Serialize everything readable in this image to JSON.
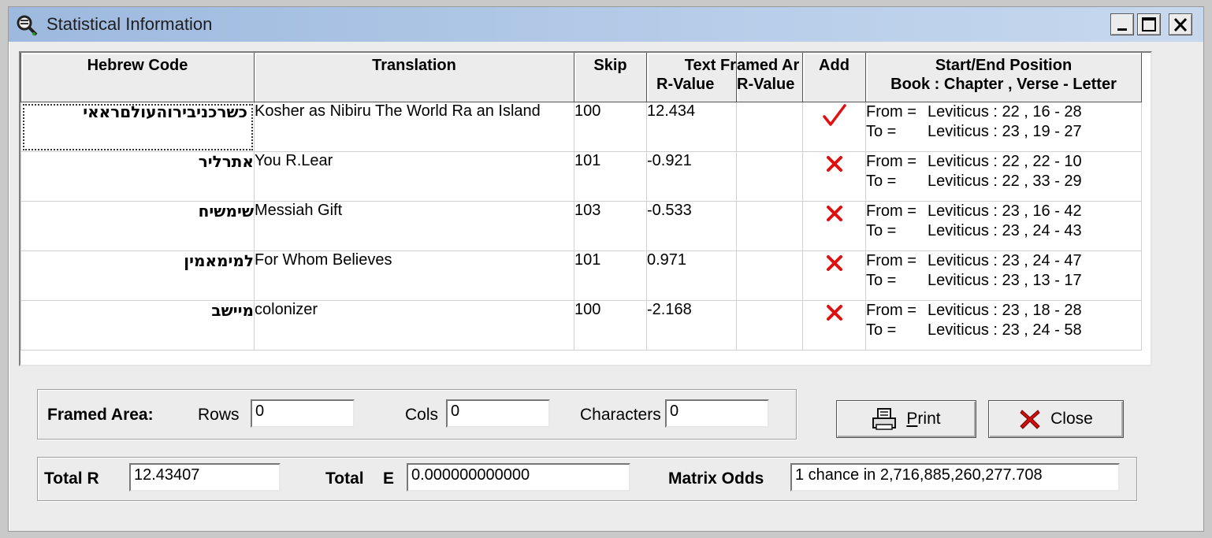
{
  "window": {
    "title": "Statistical Information"
  },
  "grid": {
    "headers": {
      "hebrew_code": "Hebrew Code",
      "translation": "Translation",
      "skip": "Skip",
      "text_line1": "Text Fr",
      "text_line2": "R-Value",
      "framed_line1": "amed Ar",
      "framed_line2": "R-Value",
      "add": "Add",
      "pos_line1": "Start/End Position",
      "pos_line2": "Book : Chapter , Verse - Letter"
    },
    "from_label": "From =",
    "to_label": "To =",
    "rows": [
      {
        "hebrew": "כשרכניבירוהעולםראאי",
        "translation": "Kosher as Nibiru The World Ra an Island",
        "skip": "100",
        "text_r": "12.434",
        "framed_r": "",
        "add": "checked",
        "from": "Leviticus : 22 , 16 - 28",
        "to": "Leviticus : 23 , 19 - 27"
      },
      {
        "hebrew": "אתרליר",
        "translation": "You R.Lear",
        "skip": "101",
        "text_r": "-0.921",
        "framed_r": "",
        "add": "unchecked",
        "from": "Leviticus : 22 , 22 - 10",
        "to": "Leviticus : 22 , 33 - 29"
      },
      {
        "hebrew": "שימשיח",
        "translation": "Messiah Gift",
        "skip": "103",
        "text_r": "-0.533",
        "framed_r": "",
        "add": "unchecked",
        "from": "Leviticus : 23 , 16 - 42",
        "to": "Leviticus : 23 , 24 - 43"
      },
      {
        "hebrew": "למימאמין",
        "translation": "For Whom Believes",
        "skip": "101",
        "text_r": "0.971",
        "framed_r": "",
        "add": "unchecked",
        "from": "Leviticus : 23 , 24 - 47",
        "to": "Leviticus : 23 , 13 - 17"
      },
      {
        "hebrew": "מיישב",
        "translation": "colonizer",
        "skip": "100",
        "text_r": "-2.168",
        "framed_r": "",
        "add": "unchecked",
        "from": "Leviticus : 23 , 18 - 28",
        "to": "Leviticus : 23 , 24 - 58"
      }
    ]
  },
  "framed_area": {
    "label": "Framed Area:",
    "rows_label": "Rows",
    "rows_value": "0",
    "cols_label": "Cols",
    "cols_value": "0",
    "chars_label": "Characters",
    "chars_value": "0"
  },
  "buttons": {
    "print_label_first": "P",
    "print_label_rest": "rint",
    "close_label": "Close"
  },
  "totals": {
    "total_r_label": "Total R",
    "total_r_value": "12.43407",
    "total_e_label": "Total",
    "total_e_letter": "E",
    "total_e_value": "0.000000000000",
    "matrix_odds_label": "Matrix Odds",
    "matrix_odds_value": "1 chance in 2,716,885,260,277.708"
  },
  "colors": {
    "check": "#e01010",
    "cross": "#e01010",
    "titlebar": "#a9c3e4"
  }
}
